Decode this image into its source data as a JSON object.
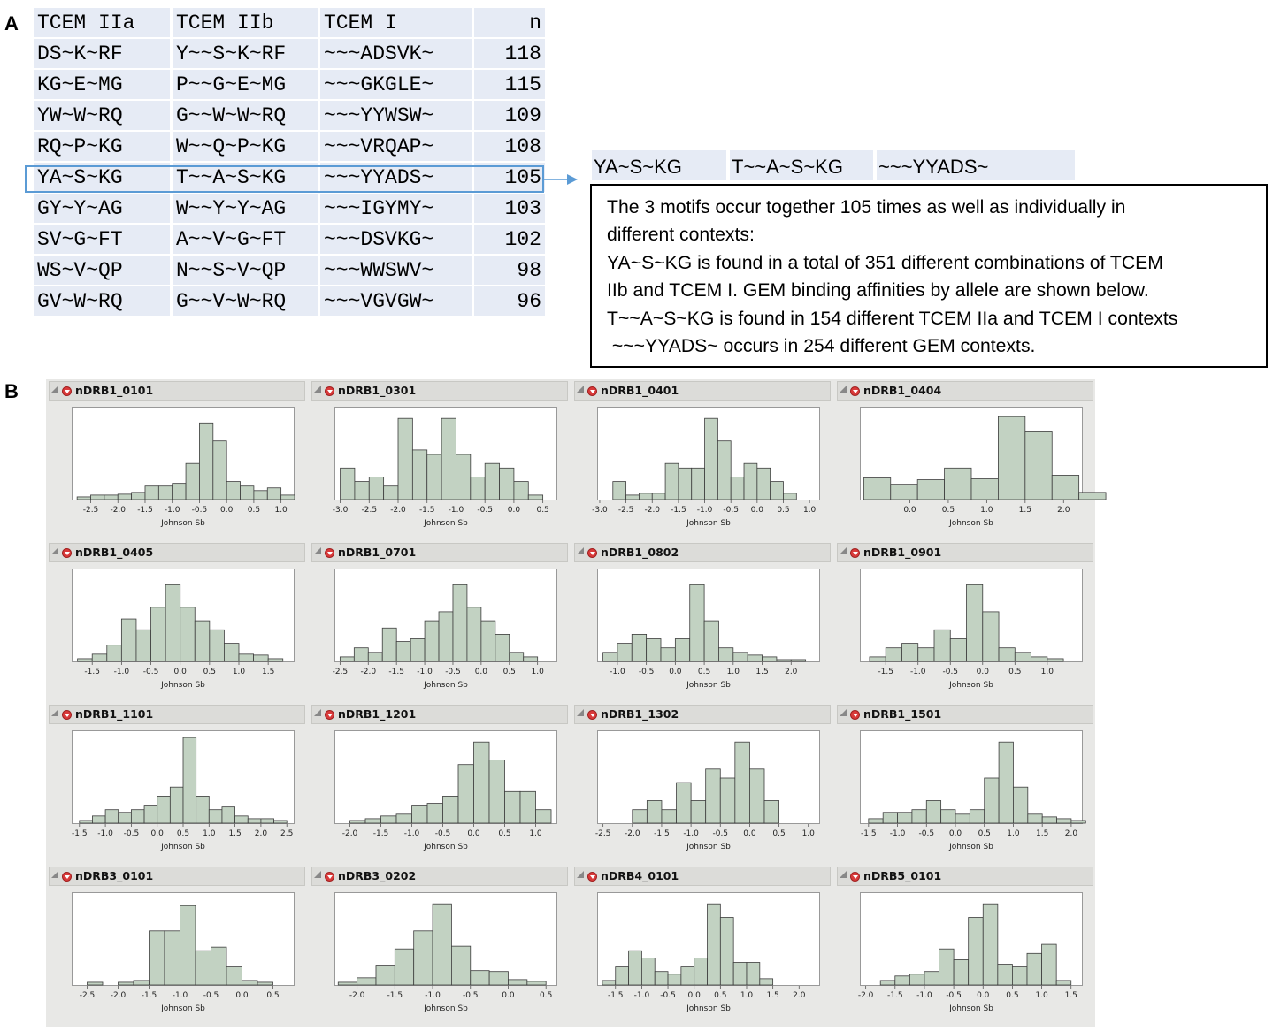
{
  "panel_a": {
    "label": "A",
    "table": {
      "headers": [
        "TCEM IIa",
        "TCEM IIb",
        "TCEM I",
        "n"
      ],
      "rows": [
        [
          "DS~K~RF",
          "Y~~S~K~RF",
          "~~~ADSVK~",
          "118"
        ],
        [
          "KG~E~MG",
          "P~~G~E~MG",
          "~~~GKGLE~",
          "115"
        ],
        [
          "YW~W~RQ",
          "G~~W~W~RQ",
          "~~~YYWSW~",
          "109"
        ],
        [
          "RQ~P~KG",
          "W~~Q~P~KG",
          "~~~VRQAP~",
          "108"
        ],
        [
          "YA~S~KG",
          "T~~A~S~KG",
          "~~~YYADS~",
          "105"
        ],
        [
          "GY~Y~AG",
          "W~~Y~Y~AG",
          "~~~IGYMY~",
          "103"
        ],
        [
          "SV~G~FT",
          "A~~V~G~FT",
          "~~~DSVKG~",
          "102"
        ],
        [
          "WS~V~QP",
          "N~~S~V~QP",
          "~~~WWSWV~",
          "98"
        ],
        [
          "GV~W~RQ",
          "G~~V~W~RQ",
          "~~~VGVGW~",
          "96"
        ]
      ],
      "highlight_row": 4,
      "highlight_color": "#5b9bd5",
      "cell_color": "#e6ebf5"
    },
    "motif_strip": [
      "YA~S~KG",
      "T~~A~S~KG",
      "~~~YYADS~"
    ],
    "note_lines": [
      "The 3 motifs occur together 105 times as well as individually in",
      "different contexts:",
      "YA~S~KG is found in a total of 351 different combinations of TCEM",
      "IIb and TCEM I.  GEM binding affinities by allele are shown below.",
      "T~~A~S~KG is found in 154 different TCEM IIa  and TCEM I contexts",
      " ~~~YYADS~ occurs in 254 different GEM contexts."
    ]
  },
  "panel_b": {
    "label": "B"
  },
  "chart_data": [
    {
      "type": "bar",
      "title": "nDRB1_0101",
      "xlabel": "Johnson Sb",
      "xlim": [
        -2.85,
        1.25
      ],
      "xticks": [
        -2.5,
        -2.0,
        -1.5,
        -1.0,
        -0.5,
        0.0,
        0.5,
        1.0
      ],
      "tick_labels": [
        "-2.5",
        "-2.0",
        "-1.5",
        "-1.0",
        "-0.5",
        "0.0",
        "0.5",
        "1.0"
      ],
      "bin_width": 0.25,
      "bins_start": -2.75,
      "values": [
        3,
        5,
        5,
        6,
        8,
        15,
        15,
        18,
        40,
        85,
        65,
        20,
        15,
        10,
        13,
        5
      ],
      "ylim": [
        0,
        100
      ],
      "bar_color": "#c2d2c2"
    },
    {
      "type": "bar",
      "title": "nDRB1_0301",
      "xlabel": "Johnson Sb",
      "xlim": [
        -3.1,
        0.75
      ],
      "xticks": [
        -3.0,
        -2.5,
        -2.0,
        -1.5,
        -1.0,
        -0.5,
        0.0,
        0.5
      ],
      "tick_labels": [
        "-3.0",
        "-2.5",
        "-2.0",
        "-1.5",
        "-1.0",
        "-0.5",
        "0.0",
        "0.5"
      ],
      "bin_width": 0.25,
      "bins_start": -3.0,
      "values": [
        35,
        20,
        25,
        15,
        90,
        55,
        50,
        90,
        50,
        25,
        40,
        35,
        20,
        5
      ],
      "ylim": [
        0,
        100
      ],
      "bar_color": "#c2d2c2"
    },
    {
      "type": "bar",
      "title": "nDRB1_0401",
      "xlabel": "Johnson Sb",
      "xlim": [
        -3.05,
        1.2
      ],
      "xticks": [
        -3.0,
        -2.5,
        -2.0,
        -1.5,
        -1.0,
        -0.5,
        0.0,
        0.5,
        1.0
      ],
      "tick_labels": [
        "-3.0",
        "-2.5",
        "-2.0",
        "-1.5",
        "-1.0",
        "-0.5",
        "0.0",
        "0.5",
        "1.0"
      ],
      "bin_width": 0.25,
      "bins_start": -2.75,
      "values": [
        20,
        5,
        7,
        7,
        40,
        35,
        35,
        90,
        65,
        25,
        40,
        35,
        20,
        7
      ],
      "ylim": [
        0,
        100
      ],
      "bar_color": "#c2d2c2"
    },
    {
      "type": "bar",
      "title": "nDRB1_0404",
      "xlabel": "Johnson Sb",
      "xlim": [
        -0.65,
        2.25
      ],
      "xticks": [
        0.0,
        0.5,
        1.0,
        1.5,
        2.0
      ],
      "tick_labels": [
        "0.0",
        "0.5",
        "1.0",
        "1.5",
        "2.0"
      ],
      "bin_width": 0.35,
      "bins_start": -0.6,
      "values": [
        24,
        17,
        22,
        35,
        23,
        92,
        75,
        27,
        8
      ],
      "ylim": [
        0,
        100
      ],
      "bar_color": "#c2d2c2"
    },
    {
      "type": "bar",
      "title": "nDRB1_0405",
      "xlabel": "Johnson Sb",
      "xlim": [
        -1.85,
        1.95
      ],
      "xticks": [
        -1.5,
        -1.0,
        -0.5,
        0.0,
        0.5,
        1.0,
        1.5
      ],
      "tick_labels": [
        "-1.5",
        "-1.0",
        "-0.5",
        "0.0",
        "0.5",
        "1.0",
        "1.5"
      ],
      "bin_width": 0.25,
      "bins_start": -1.75,
      "values": [
        3,
        8,
        18,
        47,
        35,
        60,
        85,
        60,
        45,
        35,
        20,
        8,
        7,
        3
      ],
      "ylim": [
        0,
        100
      ],
      "bar_color": "#c2d2c2"
    },
    {
      "type": "bar",
      "title": "nDRB1_0701",
      "xlabel": "Johnson Sb",
      "xlim": [
        -2.6,
        1.35
      ],
      "xticks": [
        -2.5,
        -2.0,
        -1.5,
        -1.0,
        -0.5,
        0.0,
        0.5,
        1.0
      ],
      "tick_labels": [
        "-2.5",
        "-2.0",
        "-1.5",
        "-1.0",
        "-0.5",
        "0.0",
        "0.5",
        "1.0"
      ],
      "bin_width": 0.25,
      "bins_start": -2.5,
      "values": [
        5,
        15,
        10,
        37,
        22,
        25,
        45,
        55,
        85,
        60,
        45,
        30,
        10,
        5
      ],
      "ylim": [
        0,
        100
      ],
      "bar_color": "#c2d2c2"
    },
    {
      "type": "bar",
      "title": "nDRB1_0802",
      "xlabel": "Johnson Sb",
      "xlim": [
        -1.35,
        2.5
      ],
      "xticks": [
        -1.0,
        -0.5,
        0.0,
        0.5,
        1.0,
        1.5,
        2.0
      ],
      "tick_labels": [
        "-1.0",
        "-0.5",
        "0.0",
        "0.5",
        "1.0",
        "1.5",
        "2.0"
      ],
      "bin_width": 0.25,
      "bins_start": -1.25,
      "values": [
        10,
        20,
        30,
        25,
        15,
        25,
        85,
        45,
        15,
        10,
        7,
        5,
        2,
        2
      ],
      "ylim": [
        0,
        100
      ],
      "bar_color": "#c2d2c2"
    },
    {
      "type": "bar",
      "title": "nDRB1_0901",
      "xlabel": "Johnson Sb",
      "xlim": [
        -1.9,
        1.55
      ],
      "xticks": [
        -1.5,
        -1.0,
        -0.5,
        0.0,
        0.5,
        1.0
      ],
      "tick_labels": [
        "-1.5",
        "-1.0",
        "-0.5",
        "0.0",
        "0.5",
        "1.0"
      ],
      "bin_width": 0.25,
      "bins_start": -1.75,
      "values": [
        5,
        15,
        20,
        15,
        35,
        25,
        85,
        55,
        15,
        10,
        5,
        3
      ],
      "ylim": [
        0,
        100
      ],
      "bar_color": "#c2d2c2"
    },
    {
      "type": "bar",
      "title": "nDRB1_1101",
      "xlabel": "Johnson Sb",
      "xlim": [
        -1.65,
        2.65
      ],
      "xticks": [
        -1.5,
        -1.0,
        -0.5,
        0.0,
        0.5,
        1.0,
        1.5,
        2.0,
        2.5
      ],
      "tick_labels": [
        "-1.5",
        "-1.0",
        "-0.5",
        "0.0",
        "0.5",
        "1.0",
        "1.5",
        "2.0",
        "2.5"
      ],
      "bin_width": 0.25,
      "bins_start": -1.5,
      "values": [
        3,
        8,
        15,
        12,
        15,
        20,
        30,
        40,
        95,
        30,
        15,
        18,
        8,
        5,
        5,
        3
      ],
      "ylim": [
        0,
        100
      ],
      "bar_color": "#c2d2c2"
    },
    {
      "type": "bar",
      "title": "nDRB1_1201",
      "xlabel": "Johnson Sb",
      "xlim": [
        -2.25,
        1.35
      ],
      "xticks": [
        -2.0,
        -1.5,
        -1.0,
        -0.5,
        0.0,
        0.5,
        1.0
      ],
      "tick_labels": [
        "-2.0",
        "-1.5",
        "-1.0",
        "-0.5",
        "0.0",
        "0.5",
        "1.0"
      ],
      "bin_width": 0.25,
      "bins_start": -2.0,
      "values": [
        3,
        5,
        8,
        10,
        20,
        22,
        30,
        65,
        90,
        70,
        35,
        35,
        15
      ],
      "ylim": [
        0,
        100
      ],
      "bar_color": "#c2d2c2"
    },
    {
      "type": "bar",
      "title": "nDRB1_1302",
      "xlabel": "Johnson Sb",
      "xlim": [
        -2.6,
        1.2
      ],
      "xticks": [
        -2.5,
        -2.0,
        -1.5,
        -1.0,
        -0.5,
        0.0,
        0.5,
        1.0
      ],
      "tick_labels": [
        "-2.5",
        "-2.0",
        "-1.5",
        "-1.0",
        "-0.5",
        "0.0",
        "0.5",
        "1.0"
      ],
      "bin_width": 0.25,
      "bins_start": -2.0,
      "values": [
        15,
        25,
        15,
        45,
        25,
        60,
        50,
        90,
        60,
        25
      ],
      "ylim": [
        0,
        100
      ],
      "bar_color": "#c2d2c2"
    },
    {
      "type": "bar",
      "title": "nDRB1_1501",
      "xlabel": "Johnson Sb",
      "xlim": [
        -1.65,
        2.2
      ],
      "xticks": [
        -1.5,
        -1.0,
        -0.5,
        0.0,
        0.5,
        1.0,
        1.5,
        2.0
      ],
      "tick_labels": [
        "-1.5",
        "-1.0",
        "-0.5",
        "0.0",
        "0.5",
        "1.0",
        "1.5",
        "2.0"
      ],
      "bin_width": 0.25,
      "bins_start": -1.5,
      "values": [
        5,
        12,
        12,
        15,
        25,
        15,
        10,
        15,
        50,
        90,
        40,
        10,
        7,
        5,
        3
      ],
      "ylim": [
        0,
        100
      ],
      "bar_color": "#c2d2c2"
    },
    {
      "type": "bar",
      "title": "nDRB3_0101",
      "xlabel": "Johnson Sb",
      "xlim": [
        -2.75,
        0.85
      ],
      "xticks": [
        -2.5,
        -2.0,
        -1.5,
        -1.0,
        -0.5,
        0.0,
        0.5
      ],
      "tick_labels": [
        "-2.5",
        "-2.0",
        "-1.5",
        "-1.0",
        "-0.5",
        "0.0",
        "0.5"
      ],
      "bin_width": 0.25,
      "bins_start": -2.5,
      "values": [
        3,
        0,
        3,
        5,
        60,
        60,
        88,
        38,
        42,
        20,
        5,
        3
      ],
      "ylim": [
        0,
        100
      ],
      "bar_color": "#c2d2c2"
    },
    {
      "type": "bar",
      "title": "nDRB3_0202",
      "xlabel": "Johnson Sb",
      "xlim": [
        -2.3,
        0.65
      ],
      "xticks": [
        -2.0,
        -1.5,
        -1.0,
        -0.5,
        0.0,
        0.5
      ],
      "tick_labels": [
        "-2.0",
        "-1.5",
        "-1.0",
        "-0.5",
        "0.0",
        "0.5"
      ],
      "bin_width": 0.25,
      "bins_start": -2.25,
      "values": [
        3,
        8,
        22,
        40,
        60,
        90,
        43,
        16,
        15,
        6,
        4
      ],
      "ylim": [
        0,
        100
      ],
      "bar_color": "#c2d2c2"
    },
    {
      "type": "bar",
      "title": "nDRB4_0101",
      "xlabel": "Johnson Sb",
      "xlim": [
        -1.85,
        2.4
      ],
      "xticks": [
        -1.5,
        -1.0,
        -0.5,
        0.0,
        0.5,
        1.0,
        1.5,
        2.0
      ],
      "tick_labels": [
        "-1.5",
        "-1.0",
        "-0.5",
        "0.0",
        "0.5",
        "1.0",
        "1.5",
        "2.0"
      ],
      "bin_width": 0.25,
      "bins_start": -1.75,
      "values": [
        5,
        20,
        38,
        30,
        15,
        12,
        20,
        30,
        90,
        75,
        25,
        25,
        7
      ],
      "ylim": [
        0,
        100
      ],
      "bar_color": "#c2d2c2"
    },
    {
      "type": "bar",
      "title": "nDRB5_0101",
      "xlabel": "Johnson Sb",
      "xlim": [
        -2.1,
        1.7
      ],
      "xticks": [
        -2.0,
        -1.5,
        -1.0,
        -0.5,
        0.0,
        0.5,
        1.0,
        1.5
      ],
      "tick_labels": [
        "-2.0",
        "-1.5",
        "-1.0",
        "-0.5",
        "0.0",
        "0.5",
        "1.0",
        "1.5"
      ],
      "bin_width": 0.25,
      "bins_start": -1.75,
      "values": [
        5,
        10,
        12,
        15,
        40,
        28,
        75,
        90,
        23,
        20,
        35,
        45,
        5
      ],
      "ylim": [
        0,
        100
      ],
      "bar_color": "#c2d2c2"
    }
  ]
}
